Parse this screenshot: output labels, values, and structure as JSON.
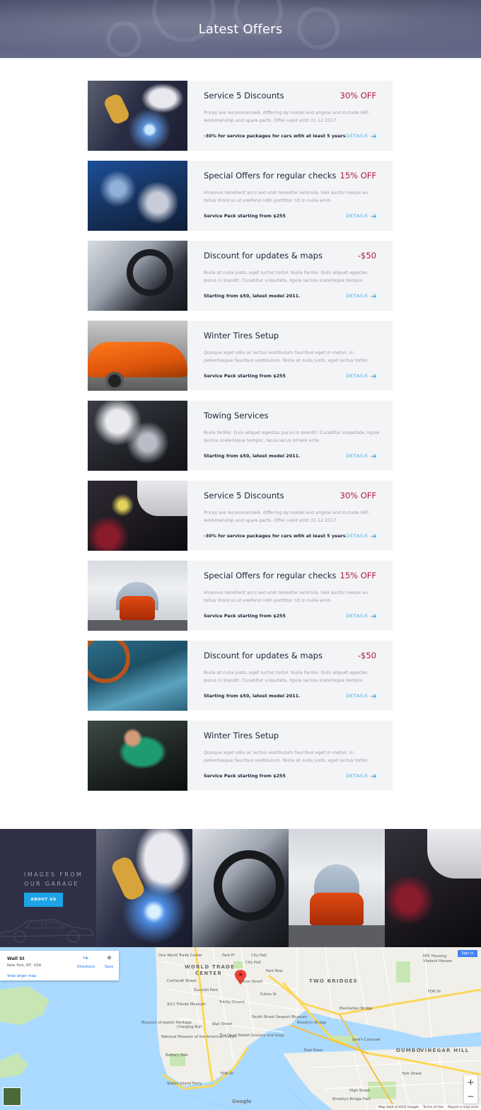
{
  "hero": {
    "title": "Latest Offers"
  },
  "offers": [
    {
      "title": "Service 5 Discounts",
      "price": "30% OFF",
      "desc": "Prices are recommended, differing by model and engine and include VAT, workmanship and spare parts. Offer valid until 31.12.2017",
      "note": "-30% for service packages for cars with at least 5 years",
      "details": "DETAILS",
      "image": "welding"
    },
    {
      "title": "Special Offers for regular checks",
      "price": "15% OFF",
      "desc": "Vivamus hendrerit arcu sed erat molestie vehicula. Sed auctor neque eu tellus rhoncus ut eleifend nibh porttitor. Ut in nulla enim.",
      "note": "Service Pack starting from $255",
      "details": "DETAILS",
      "image": "engine-blue"
    },
    {
      "title": "Discount for updates & maps",
      "price": "-$50",
      "desc": "Nulla at nulla justo, eget luctus tortor. Nulla facilisi. Duis aliquet egestas purus in blandit. Curabitur vulputate, ligula lacinia scelerisque tempor.",
      "note": "Starting from $50, latest model 2011.",
      "details": "DETAILS",
      "image": "steering-wheel"
    },
    {
      "title": "Winter Tires Setup",
      "price": "",
      "desc": "Quisque eget odio ac lectus vestibulum faucibus eget in metus. In pellentesque faucibus vestibulum. Nulla at nulla justo, eget luctus tortor.",
      "note": "Service Pack starting from $255",
      "details": "DETAILS",
      "image": "orange-car"
    },
    {
      "title": "Towing Services",
      "price": "",
      "desc": "Nulla facilisi. Duis aliquet egestas purus in blandit. Curabitur vulputate, ligula lacinia scelerisque tempor, lacus lacus ornare ante.",
      "note": "Starting from $50, latest model 2011.",
      "details": "DETAILS",
      "image": "engine-hands"
    },
    {
      "title": "Service 5 Discounts",
      "price": "30% OFF",
      "desc": "Prices are recommended, differing by model and engine and include VAT, workmanship and spare parts. Offer valid until 31.12.2017",
      "note": "-30% for service packages for cars with at least 5 years",
      "details": "DETAILS",
      "image": "oil-check"
    },
    {
      "title": "Special Offers for regular checks",
      "price": "15% OFF",
      "desc": "Vivamus hendrerit arcu sed erat molestie vehicula. Sed auctor neque eu tellus rhoncus ut eleifend nibh porttitor. Ut in nulla enim.",
      "note": "Service Pack starting from $255",
      "details": "DETAILS",
      "image": "paint-booth"
    },
    {
      "title": "Discount for updates & maps",
      "price": "-$50",
      "desc": "Nulla at nulla justo, eget luctus tortor. Nulla facilisi. Duis aliquet egestas purus in blandit. Curabitur vulputate, ligula lacinia scelerisque tempor.",
      "note": "Starting from $50, latest model 2011.",
      "details": "DETAILS",
      "image": "blue-interior"
    },
    {
      "title": "Winter Tires Setup",
      "price": "",
      "desc": "Quisque eget odio ac lectus vestibulum faucibus eget in metus. In pellentesque faucibus vestibulum. Nulla at nulla justo, eget luctus tortor.",
      "note": "Service Pack starting from $255",
      "details": "DETAILS",
      "image": "mechanic-green"
    }
  ],
  "gallery": {
    "title_line1": "IMAGES FROM",
    "title_line2": "OUR GARAGE",
    "button": "ABOUT US"
  },
  "map": {
    "place": "Wall St",
    "address": "New York, NY, USA",
    "directions": "Directions",
    "save": "Save",
    "larger_map": "View larger map",
    "sign_in": "Sign in",
    "zoom_in": "+",
    "zoom_out": "−",
    "google": "Google",
    "footer_data": "Map data ©2018 Google",
    "footer_terms": "Terms of Use",
    "footer_report": "Report a map error",
    "labels": {
      "one_world": "One World Trade Center",
      "park_pl": "Park Pl",
      "city_hall": "City Hall",
      "nyc_housing": "NYC Housing",
      "vladeck": "Vladeck Houses",
      "wtc_1": "WORLD TRADE",
      "wtc_2": "CENTER",
      "city_hall_2": "City Hall",
      "cortlandt": "Cortlandt Street",
      "park_row": "Park Row",
      "fulton_st": "Fulton Street",
      "zuccotti": "Zuccotti Park",
      "two_bridges": "TWO BRIDGES",
      "fdr": "FDR Dr",
      "tribute": "9/11 Tribute Museum",
      "trinity": "Trinity Church",
      "fulton_st_2": "Fulton St",
      "manhattan_bridge": "Manhattan Bridge",
      "museum_jewish": "Museum of Jewish Heritage",
      "charging_bull": "Charging Bull",
      "wall_street": "Wall Street",
      "south_street": "South Street Seaport Museum",
      "brooklyn_bridge": "Brooklyn Bridge",
      "national_museum": "National Museum of the American Indian",
      "dead_rabbit": "The Dead Rabbit Grocery and Grog",
      "east_river": "East River",
      "janes_carousel": "Jane's Carousel",
      "dumbo": "DUMBO",
      "vinegar_hill": "VINEGAR HILL",
      "battery_park": "Battery Park",
      "york_street": "York Street",
      "fdr_2": "FDR Dr",
      "staten_island": "Staten Island Ferry",
      "high_street": "High Street",
      "brooklyn_bridge_park": "Brooklyn Bridge Park"
    }
  }
}
